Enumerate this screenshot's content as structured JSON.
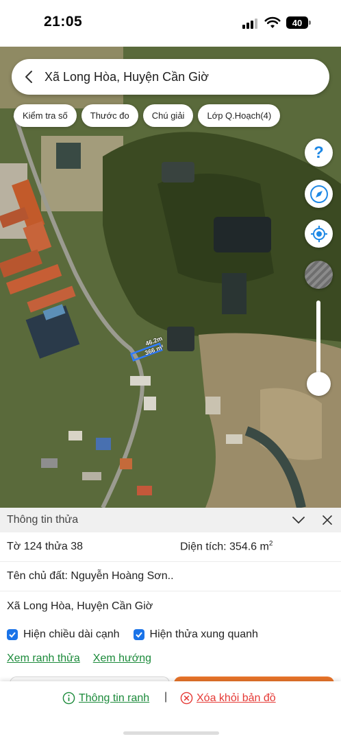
{
  "status": {
    "time": "21:05",
    "battery": "40"
  },
  "header": {
    "title": "Xã Long Hòa, Huyện Cần Giờ"
  },
  "chips": [
    "Kiểm tra số",
    "Thước đo",
    "Chú giải",
    "Lớp Q.Hoạch(4)"
  ],
  "map": {
    "parcel_length": "46.2m",
    "parcel_area": "366 m²",
    "fab_help": "?",
    "zoom_level": 0.2,
    "colors": {
      "accent_blue": "#1e88e5",
      "parcel_outline": "#2f7bff"
    },
    "icons": [
      "back-arrow-icon",
      "question-icon",
      "compass-icon",
      "locate-icon",
      "layer-icon"
    ]
  },
  "parcel_info": {
    "title": "Thông tin thửa",
    "sheet_number": "Tờ 124 thửa 38",
    "area_label": "Diện tích: 354.6 m",
    "area_sup": "2",
    "owner": "Tên chủ đất: Nguyễn Hoàng Sơn..",
    "address": "Xã Long Hòa, Huyện Cần Giờ",
    "options": [
      {
        "label": "Hiện chiều dài cạnh",
        "checked": true
      },
      {
        "label": "Hiện thửa xung quanh",
        "checked": true
      }
    ],
    "links": [
      "Xem ranh thửa",
      "Xem hướng"
    ]
  },
  "bottom_bar": {
    "info_label": "Thông tin ranh",
    "separator": "|",
    "remove_label": "Xóa khỏi bản đồ",
    "colors": {
      "info": "#1b8a3a",
      "remove": "#e53935"
    }
  }
}
